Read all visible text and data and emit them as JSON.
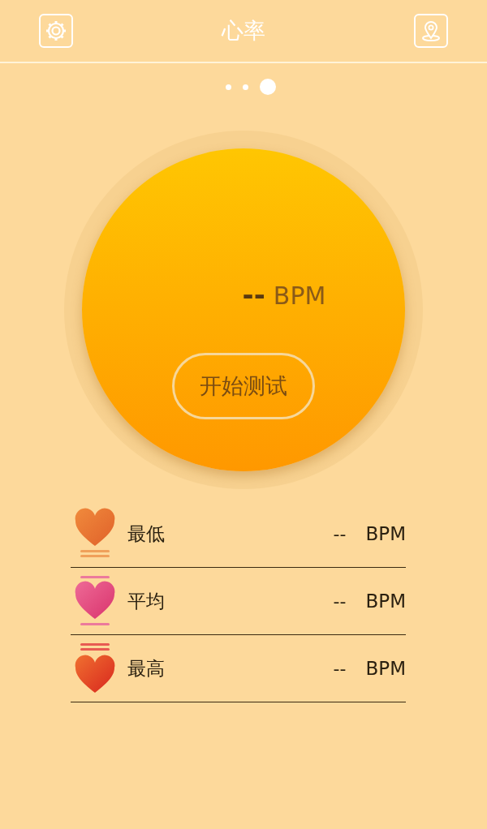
{
  "header": {
    "title": "心率"
  },
  "pager": [
    {
      "selected": false
    },
    {
      "selected": false
    },
    {
      "selected": true
    }
  ],
  "measure": {
    "value": "--",
    "unit": "BPM",
    "button": "开始测试"
  },
  "stats": [
    {
      "kind": "low",
      "label": "最低",
      "value": "--",
      "unit": "BPM"
    },
    {
      "kind": "average",
      "label": "平均",
      "value": "--",
      "unit": "BPM"
    },
    {
      "kind": "high",
      "label": "最高",
      "value": "--",
      "unit": "BPM"
    }
  ]
}
